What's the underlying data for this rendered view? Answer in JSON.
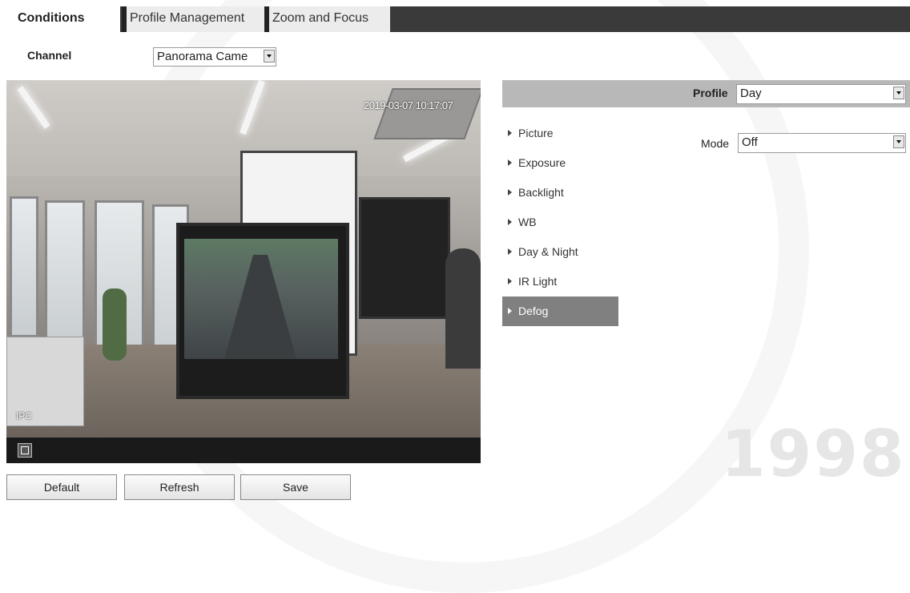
{
  "tabs": [
    {
      "label": "Conditions"
    },
    {
      "label": "Profile Management"
    },
    {
      "label": "Zoom and Focus"
    }
  ],
  "channel": {
    "label": "Channel",
    "value": "Panorama Came"
  },
  "video": {
    "timestamp": "2019-03-07 10:17:07",
    "channel_title": "IPC"
  },
  "buttons": {
    "default": "Default",
    "refresh": "Refresh",
    "save": "Save"
  },
  "profile": {
    "label": "Profile",
    "value": "Day"
  },
  "nav": {
    "items": [
      "Picture",
      "Exposure",
      "Backlight",
      "WB",
      "Day & Night",
      "IR Light",
      "Defog"
    ],
    "active": "Defog"
  },
  "mode": {
    "label": "Mode",
    "value": "Off"
  },
  "watermark": {
    "year": "1998"
  },
  "colors": {
    "tab_strip": "#3a3a3a",
    "nav_active": "#808080",
    "profile_bar": "#b8b8b8"
  }
}
